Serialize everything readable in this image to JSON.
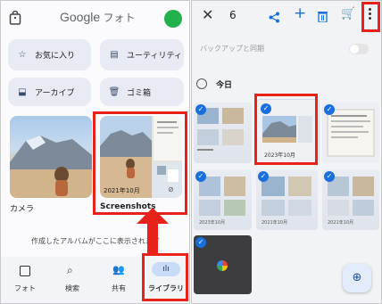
{
  "left": {
    "logo_google": "Google",
    "logo_photos": " フォト",
    "chips": {
      "favorites": "お気に入り",
      "utility": "ユーティリティ",
      "archive": "アーカイブ",
      "trash": "ゴミ箱"
    },
    "albums": {
      "camera_label": "カメラ",
      "screenshots_date": "2021年10月",
      "screenshots_label": "Screenshots"
    },
    "hint": "作成したアルバムがここに表示されます",
    "nav": {
      "photos": "フォト",
      "search": "検索",
      "shared": "共有",
      "library": "ライブラリ"
    }
  },
  "right": {
    "selected_count": "6",
    "backup_label": "バックアップと同期",
    "today_label": "今日",
    "tile_date": "2023年10月",
    "tile_date_b": "2023年10月",
    "tile_date_c": "2021年10月",
    "tile_date_d": "2021年10月"
  },
  "colors": {
    "highlight": "#e8211a",
    "accent_blue": "#1a6fe0",
    "avatar_green": "#22b14c"
  }
}
